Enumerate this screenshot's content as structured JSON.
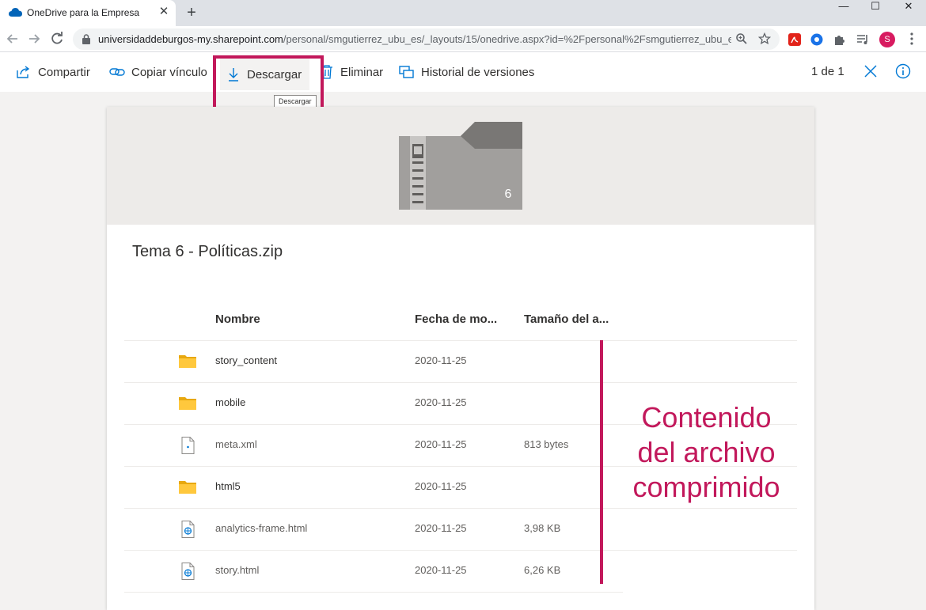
{
  "browser": {
    "tab_title": "OneDrive para la Empresa",
    "tab_close": "✕",
    "new_tab": "+",
    "window_minimize": "—",
    "window_maximize": "☐",
    "window_close": "✕",
    "url_host": "universidaddeburgos-my.sharepoint.com",
    "url_path": "/personal/smgutierrez_ubu_es/_layouts/15/onedrive.aspx?id=%2Fpersonal%2Fsmgutierrez_ubu_e...",
    "avatar_letter": "S",
    "icons": [
      "onedrive-cloud-icon",
      "back-arrow-icon",
      "forward-arrow-icon",
      "reload-icon",
      "lock-icon",
      "zoom-icon",
      "star-icon",
      "pdf-extension-icon",
      "extension-icon",
      "puzzle-icon",
      "media-icon",
      "kebab-menu-icon"
    ]
  },
  "commandbar": {
    "share": "Compartir",
    "copy_link": "Copiar vínculo",
    "download": "Descargar",
    "download_tooltip": "Descargar",
    "delete": "Eliminar",
    "versions": "Historial de versiones",
    "page_count": "1 de 1"
  },
  "preview": {
    "zip_badge": "6",
    "file_name": "Tema 6 - Políticas.zip",
    "columns": {
      "name": "Nombre",
      "date": "Fecha de mo...",
      "size": "Tamaño del a..."
    },
    "rows": [
      {
        "name": "story_content",
        "date": "2020-11-25",
        "size": "",
        "icon": "folder-icon"
      },
      {
        "name": "mobile",
        "date": "2020-11-25",
        "size": "",
        "icon": "folder-icon"
      },
      {
        "name": "meta.xml",
        "date": "2020-11-25",
        "size": "813 bytes",
        "icon": "xml-file-icon"
      },
      {
        "name": "html5",
        "date": "2020-11-25",
        "size": "",
        "icon": "folder-icon"
      },
      {
        "name": "analytics-frame.html",
        "date": "2020-11-25",
        "size": "3,98 KB",
        "icon": "html-file-icon"
      },
      {
        "name": "story.html",
        "date": "2020-11-25",
        "size": "6,26 KB",
        "icon": "html-file-icon"
      }
    ]
  },
  "annotation": {
    "line1": "Contenido",
    "line2": "del archivo",
    "line3": "comprimido"
  },
  "colors": {
    "accent": "#0078d4",
    "highlight": "#c2185b",
    "folder": "#ffc83d"
  }
}
